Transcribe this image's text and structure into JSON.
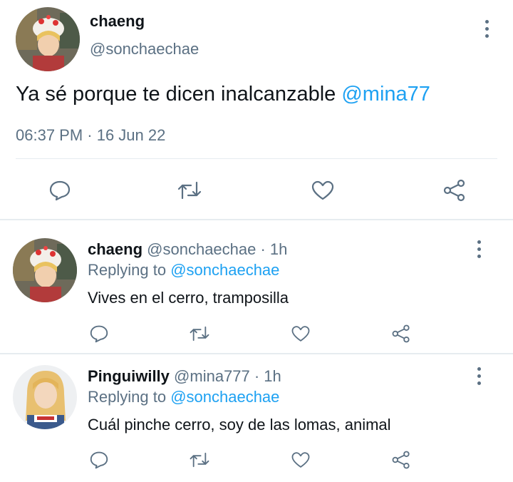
{
  "main_tweet": {
    "display_name": "chaeng",
    "handle": "@sonchaechae",
    "text": "Ya sé porque te dicen inalcanzable ",
    "mention": "@mina77",
    "timestamp": "06:37 PM · 16 Jun 22",
    "avatar_icon": "avatar-photo"
  },
  "replies": [
    {
      "display_name": "chaeng",
      "handle": "@sonchaechae · 1h",
      "replying_prefix": "Replying to ",
      "replying_handle": "@sonchaechae",
      "text": "Vives en el cerro, tramposilla"
    },
    {
      "display_name": "Pinguiwilly",
      "handle": "@mina777 · 1h",
      "replying_prefix": "Replying to ",
      "replying_handle": "@sonchaechae",
      "text": "Cuál pinche cerro, soy de las lomas, animal"
    }
  ],
  "icons": [
    "reply-icon",
    "retweet-icon",
    "like-icon",
    "share-icon",
    "more-icon"
  ],
  "colors": {
    "link": "#1da1f2",
    "muted": "#5b7083",
    "text": "#0f1419",
    "divider": "#e6ecf0"
  }
}
